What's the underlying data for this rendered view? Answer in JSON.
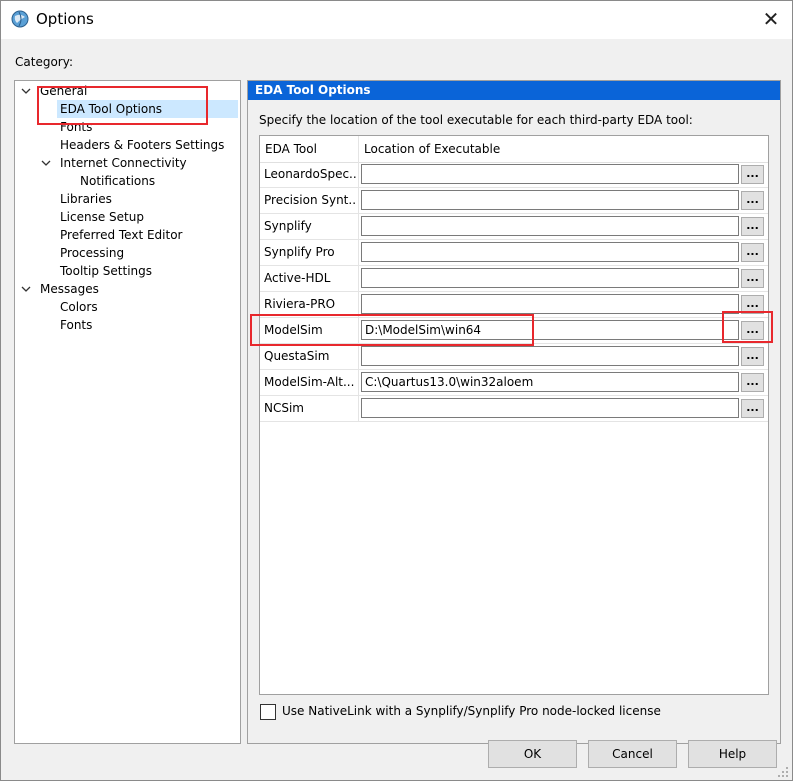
{
  "window": {
    "title": "Options",
    "close_glyph": "✕",
    "app_icon": "quartus-globe-icon"
  },
  "category_label": "Category:",
  "tree": {
    "items": [
      {
        "label": "General",
        "expanded": true
      },
      {
        "label": "EDA Tool Options",
        "selected": true
      },
      {
        "label": "Fonts"
      },
      {
        "label": "Headers & Footers Settings"
      },
      {
        "label": "Internet Connectivity",
        "expanded": true
      },
      {
        "label": "Notifications"
      },
      {
        "label": "Libraries"
      },
      {
        "label": "License Setup"
      },
      {
        "label": "Preferred Text Editor"
      },
      {
        "label": "Processing"
      },
      {
        "label": "Tooltip Settings"
      },
      {
        "label": "Messages",
        "expanded": true
      },
      {
        "label": "Colors"
      },
      {
        "label": "Fonts"
      }
    ]
  },
  "panel": {
    "title": "EDA Tool Options",
    "description": "Specify the location of the tool executable for each third-party EDA tool:",
    "columns": [
      "EDA Tool",
      "Location of Executable"
    ],
    "browse_label": "...",
    "rows": [
      {
        "tool": "LeonardoSpec...",
        "path": ""
      },
      {
        "tool": "Precision Synt...",
        "path": ""
      },
      {
        "tool": "Synplify",
        "path": ""
      },
      {
        "tool": "Synplify Pro",
        "path": ""
      },
      {
        "tool": "Active-HDL",
        "path": ""
      },
      {
        "tool": "Riviera-PRO",
        "path": ""
      },
      {
        "tool": "ModelSim",
        "path": "D:\\ModelSim\\win64"
      },
      {
        "tool": "QuestaSim",
        "path": ""
      },
      {
        "tool": "ModelSim-Alt...",
        "path": "C:\\Quartus13.0\\win32aloem"
      },
      {
        "tool": "NCSim",
        "path": ""
      }
    ],
    "nativelink_label": "Use NativeLink with a Synplify/Synplify Pro node-locked license",
    "nativelink_checked": false
  },
  "buttons": {
    "ok": "OK",
    "cancel": "Cancel",
    "help": "Help"
  },
  "colors": {
    "header_blue": "#0a64d8",
    "selection": "#cce8ff",
    "annotation_red": "#e8282d"
  }
}
